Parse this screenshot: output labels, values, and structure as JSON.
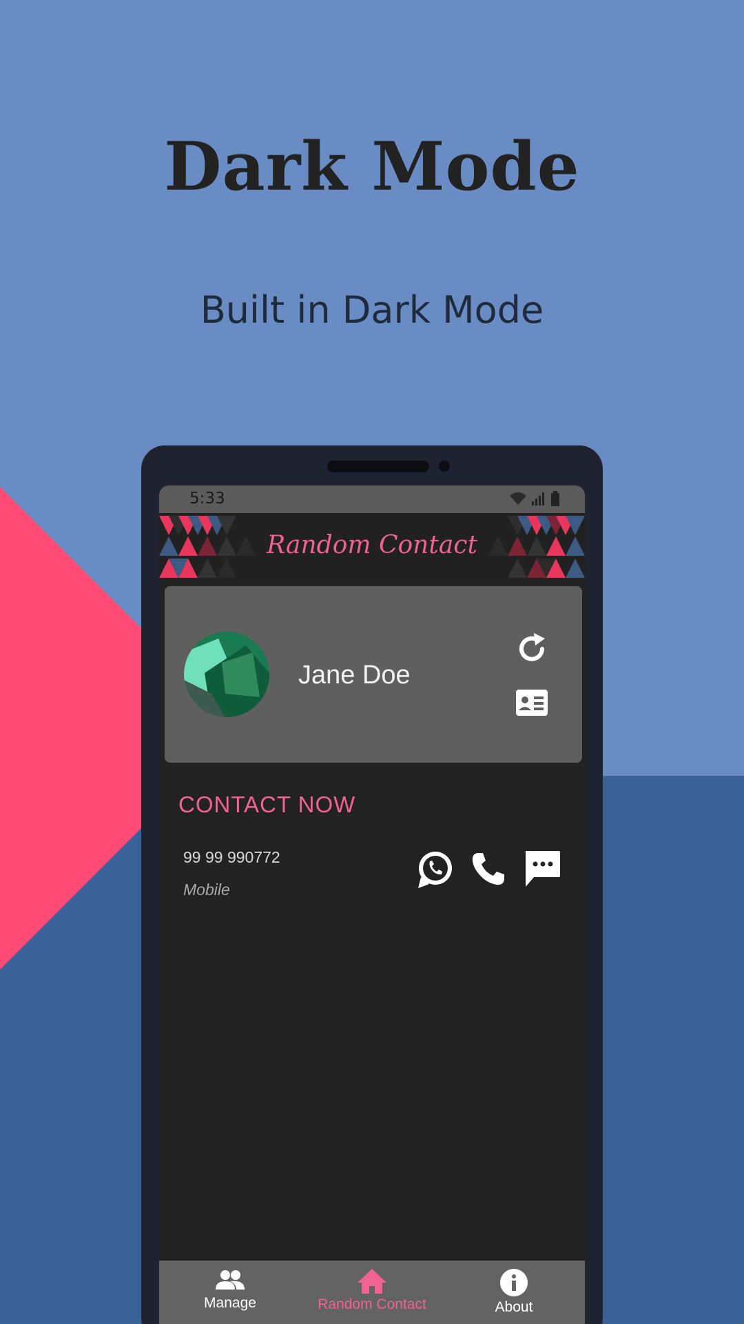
{
  "promo": {
    "title": "Dark Mode",
    "subtitle": "Built in Dark Mode"
  },
  "status_bar": {
    "time": "5:33"
  },
  "app_bar": {
    "title": "Random Contact"
  },
  "contact_card": {
    "name": "Jane Doe",
    "avatar_icon": "avatar-image",
    "refresh_icon": "refresh-icon",
    "contact_card_icon": "contact-card-icon"
  },
  "contact_now": {
    "heading": "CONTACT NOW",
    "number": "99 99 990772",
    "type": "Mobile",
    "actions": [
      "whatsapp-icon",
      "phone-icon",
      "message-icon"
    ]
  },
  "bottom_nav": {
    "items": [
      {
        "label": "Manage",
        "icon": "people-icon",
        "active": false
      },
      {
        "label": "Random Contact",
        "icon": "home-icon",
        "active": true
      },
      {
        "label": "About",
        "icon": "info-icon",
        "active": false
      }
    ]
  },
  "colors": {
    "accent": "#f06292",
    "background_top": "#6a8cc4",
    "background_bottom": "#3b6199",
    "decor_triangle": "#ff4a76",
    "phone_frame": "#1f2230",
    "screen_bg": "#222222",
    "card_bg": "#5f5f5f"
  }
}
